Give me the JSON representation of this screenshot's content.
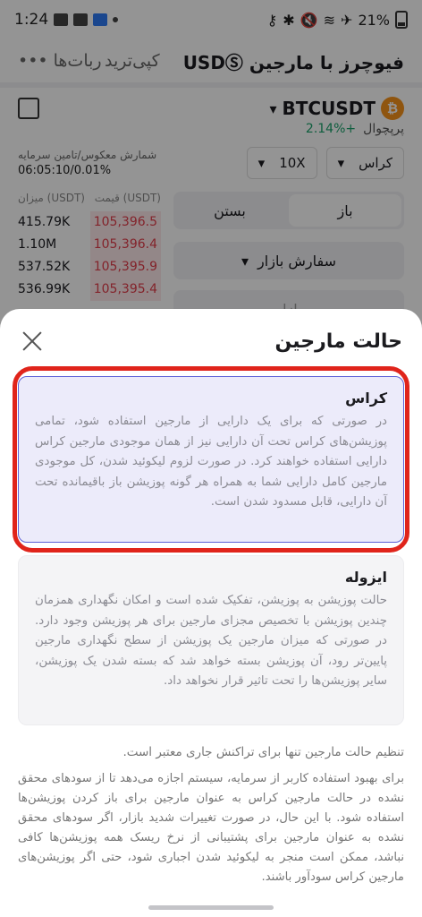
{
  "status_bar": {
    "time": "1:24",
    "battery": "21%"
  },
  "background": {
    "title": "فیوچرز با مارجین USDⓈ",
    "tab_copy": "کپی‌ترید",
    "tab_bots": "ربات‌ها",
    "more": "•••",
    "pair": "BTCUSDT",
    "coin_symbol": "₿",
    "perpetual": "پرپچوال",
    "change": "+2.14%",
    "funding_label": "شمارش معکوس/تامین سرمایه",
    "funding_value": "06:05:10/0.01%",
    "margin_mode": "کراس",
    "leverage": "10X",
    "price_header": "قیمت (USDT)",
    "amount_header": "میزان (USDT)",
    "rows": [
      {
        "price": "105,396.5",
        "amount": "415.79K"
      },
      {
        "price": "105,396.4",
        "amount": "1.10M"
      },
      {
        "price": "105,395.9",
        "amount": "537.52K"
      },
      {
        "price": "105,395.4",
        "amount": "536.99K"
      }
    ],
    "open_label": "باز",
    "close_label": "بستن",
    "order_type": "سفارش بازار",
    "market_label": "بازار"
  },
  "sheet": {
    "title": "حالت مارجین",
    "options": [
      {
        "title": "کراس",
        "description": "در صورتی که برای یک دارایی از مارجین استفاده شود، تمامی پوزیشن‌های کراس تحت آن دارایی نیز از همان موجودی مارجین کراس دارایی استفاده خواهند کرد. در صورت لزوم لیکوئید شدن، کل موجودی مارجین کامل دارایی شما به همراه هر گونه پوزیشن باز باقیمانده تحت آن دارایی، قابل مسدود شدن است."
      },
      {
        "title": "ایزوله",
        "description": "حالت پوزیشن به پوزیشن، تفکیک شده است و امکان نگهداری همزمان چندین پوزیشن با تخصیص مجزای مارجین برای هر پوزیشن وجود دارد. در صورتی که میزان مارجین یک پوزیشن از سطح نگهداری مارجین پایین‌تر رود، آن پوزیشن بسته خواهد شد که بسته شدن یک پوزیشن، سایر پوزیشن‌ها را تحت تاثیر قرار نخواهد داد."
      }
    ],
    "note": "تنظیم حالت مارجین تنها برای تراکنش جاری معتبر است.",
    "disclaimer": "برای بهبود استفاده کاربر از سرمایه، سیستم اجازه می‌دهد تا از سودهای محقق نشده در حالت مارجین کراس به عنوان مارجین برای باز کردن پوزیشن‌ها استفاده شود. با این حال، در صورت تغییرات شدید بازار، اگر سودهای محقق نشده به عنوان مارجین برای پشتیبانی از نرخ ریسک همه پوزیشن‌ها کافی نباشد، ممکن است منجر به لیکوئید شدن اجباری شود، حتی اگر پوزیشن‌های مارجین کراس سودآور باشند."
  },
  "colors": {
    "accent": "#5b5fd6",
    "highlight": "#e0241b",
    "ask": "#e23d4b",
    "bid": "#1aa36b"
  }
}
